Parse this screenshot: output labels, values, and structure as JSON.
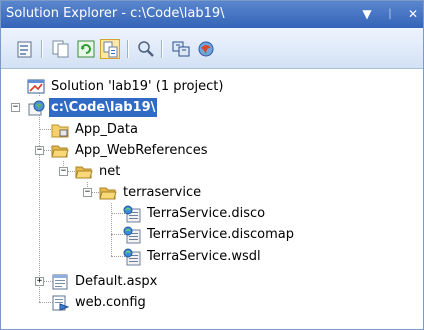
{
  "window": {
    "title": "Solution Explorer - c:\\Code\\lab19\\",
    "titlebar_buttons": [
      {
        "name": "dropdown-arrow-icon",
        "glyph": "▼"
      },
      {
        "name": "pin-icon",
        "glyph": "ᛁ"
      },
      {
        "name": "close-icon",
        "glyph": "✕"
      }
    ],
    "colors": {
      "titlebar": "#3c6dbf",
      "selection": "#316ac5",
      "folder": "#f2c65d"
    }
  },
  "toolbar": {
    "buttons": [
      {
        "name": "properties-icon",
        "active": false
      },
      {
        "name": "show-all-files-icon",
        "active": false
      },
      {
        "name": "refresh-icon",
        "active": false
      },
      {
        "name": "nest-related-files-icon",
        "active": true
      },
      {
        "name": "view-code-icon",
        "active": false
      },
      {
        "name": "copy-website-icon",
        "active": false
      },
      {
        "name": "asp-net-configuration-icon",
        "active": false
      }
    ]
  },
  "tree": {
    "items": [
      {
        "label": "Solution 'lab19' (1 project)",
        "icon": "solution-icon",
        "expander": "",
        "selected": false
      },
      {
        "label": "c:\\Code\\lab19\\",
        "icon": "website-project-icon",
        "expander": "−",
        "selected": true
      },
      {
        "label": "App_Data",
        "icon": "folder-icon",
        "expander": "",
        "selected": false
      },
      {
        "label": "App_WebReferences",
        "icon": "folder-open-icon",
        "expander": "−",
        "selected": false
      },
      {
        "label": "net",
        "icon": "folder-open-icon",
        "expander": "−",
        "selected": false
      },
      {
        "label": "terraservice",
        "icon": "folder-open-icon",
        "expander": "−",
        "selected": false
      },
      {
        "label": "TerraService.disco",
        "icon": "web-service-file-icon",
        "expander": "",
        "selected": false
      },
      {
        "label": "TerraService.discomap",
        "icon": "web-service-file-icon",
        "expander": "",
        "selected": false
      },
      {
        "label": "TerraService.wsdl",
        "icon": "web-service-file-icon",
        "expander": "",
        "selected": false
      },
      {
        "label": "Default.aspx",
        "icon": "aspx-file-icon",
        "expander": "+",
        "selected": false
      },
      {
        "label": "web.config",
        "icon": "config-file-icon",
        "expander": "",
        "selected": false
      }
    ]
  }
}
